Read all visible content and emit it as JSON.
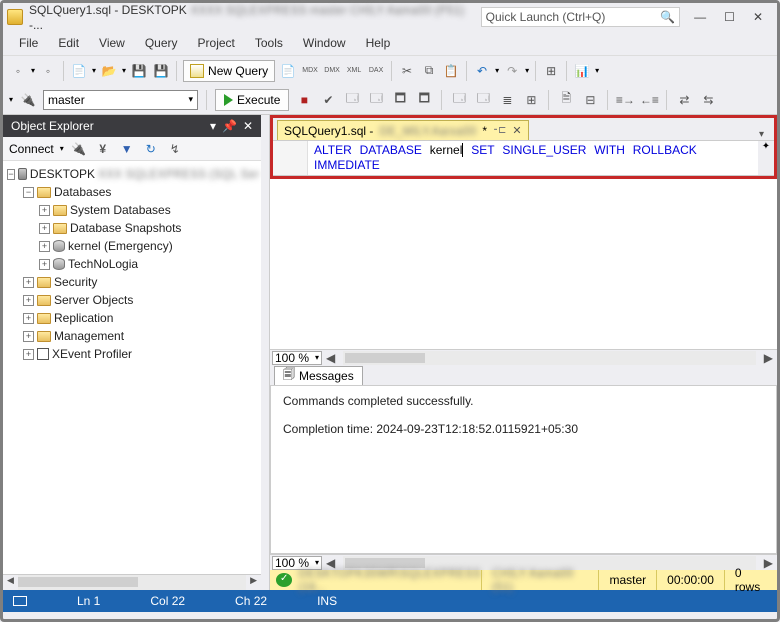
{
  "title": "SQLQuery1.sql - DESKTOPK",
  "title_suffix": "-...",
  "quick_launch_placeholder": "Quick Launch (Ctrl+Q)",
  "menu": [
    "File",
    "Edit",
    "View",
    "Query",
    "Project",
    "Tools",
    "Window",
    "Help"
  ],
  "toolbar": {
    "new_query": "New Query",
    "db_selected": "master",
    "execute": "Execute"
  },
  "object_explorer": {
    "title": "Object Explorer",
    "connect": "Connect",
    "server": "DESKTOPK",
    "server_suffix": "(SQL Server...)",
    "nodes": {
      "databases": "Databases",
      "system_databases": "System Databases",
      "database_snapshots": "Database Snapshots",
      "kernel": "kernel (Emergency)",
      "techno": "TechNoLogia",
      "security": "Security",
      "server_objects": "Server Objects",
      "replication": "Replication",
      "management": "Management",
      "xevent": "XEvent Profiler"
    }
  },
  "editor": {
    "tab_name": "SQLQuery1.sql -",
    "tab_suffix": "*",
    "sql_tokens": {
      "t1": "ALTER",
      "t2": "DATABASE",
      "ident": "kernel",
      "t3": "SET",
      "t4": "SINGLE_USER",
      "t5": "WITH",
      "t6": "ROLLBACK",
      "t7": "IMMEDIATE"
    },
    "zoom": "100 %"
  },
  "messages": {
    "tab": "Messages",
    "line1": "Commands completed successfully.",
    "line2": "Completion time: 2024-09-23T12:18:52.0115921+05:30",
    "zoom": "100 %"
  },
  "yellow_status": {
    "server": "DESKTOPK/SQLEXPRESS (16...)",
    "user": "USER",
    "db": "master",
    "time": "00:00:00",
    "rows": "0 rows"
  },
  "main_status": {
    "line": "Ln 1",
    "col": "Col 22",
    "ch": "Ch 22",
    "ins": "INS"
  }
}
